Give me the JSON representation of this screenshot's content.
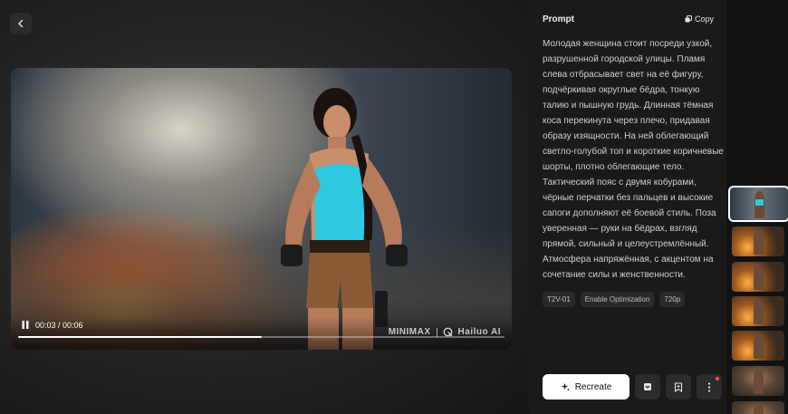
{
  "player": {
    "time_display": "00:03 / 00:06",
    "progress_fraction": 0.5,
    "watermark_brand": "MINIMAX",
    "watermark_app": "Hailuo AI"
  },
  "panel": {
    "title": "Prompt",
    "copy_label": "Copy",
    "prompt_text": "Молодая женщина стоит посреди узкой, разрушенной городской улицы. Пламя слева отбрасывает свет на её фигуру, подчёркивая округлые бёдра, тонкую талию и пышную грудь. Длинная тёмная коса перекинута через плечо, придавая образу изящности. На ней облегающий светло-голубой топ и короткие коричневые шорты, плотно облегающие тело. Тактический пояс с двумя кобурами, чёрные перчатки без пальцев и высокие сапоги дополняют её боевой стиль. Поза уверенная — руки на бёдрах, взгляд прямой, сильный и целеустремлённый. Атмосфера напряжённая, с акцентом на сочетание силы и женственности.",
    "tags": [
      "T2V-01",
      "Enable Optimization",
      "720p"
    ],
    "recreate_label": "Recreate"
  },
  "colors": {
    "accent_top": "#2ec8e0",
    "notification_dot": "#ff4d4d"
  }
}
